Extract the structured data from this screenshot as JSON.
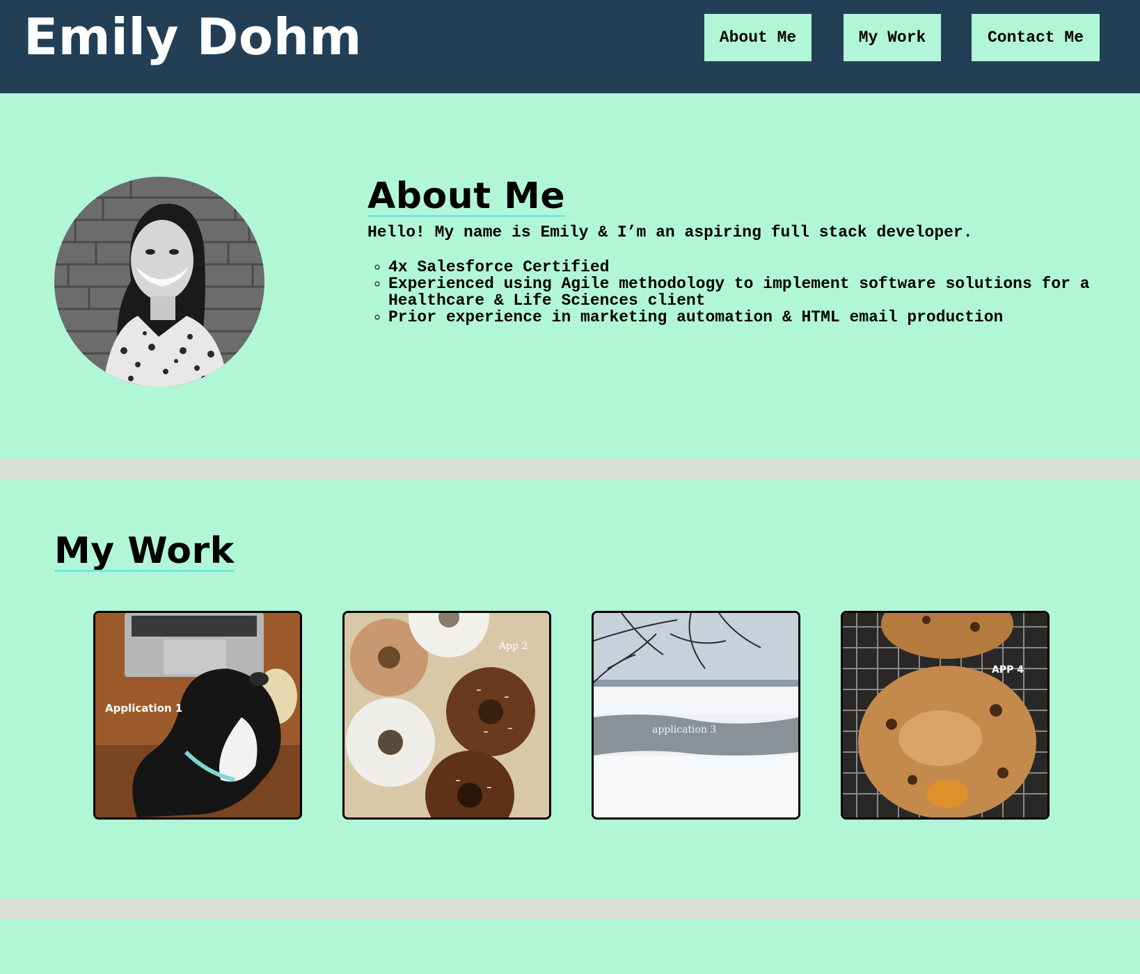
{
  "header": {
    "title": "Emily Dohm",
    "nav": {
      "about": "About Me",
      "work": "My Work",
      "contact": "Contact Me"
    }
  },
  "about": {
    "heading": "About Me",
    "intro": "Hello! My name is Emily & I’m an aspiring full stack developer.",
    "bullets": [
      "4x Salesforce Certified",
      "Experienced using Agile methodology to implement software solutions for a Healthcare & Life Sciences client",
      "Prior experience in marketing automation & HTML email production"
    ]
  },
  "work": {
    "heading": "My Work",
    "projects": [
      {
        "label": "Application 1"
      },
      {
        "label": "App 2"
      },
      {
        "label": "application 3"
      },
      {
        "label": "APP 4"
      }
    ]
  },
  "colors": {
    "header_bg": "#223f56",
    "page_bg": "#b2f6d8",
    "divider": "#dbdfda",
    "heading_underline": "#6de8e2"
  }
}
